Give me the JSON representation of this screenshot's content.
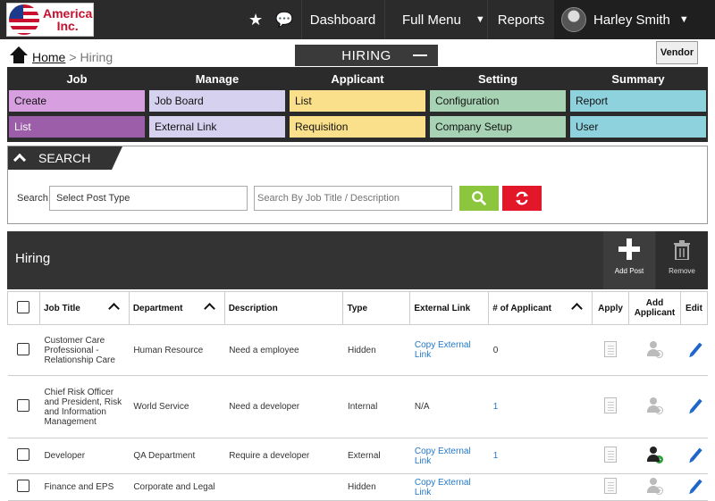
{
  "brand": {
    "line1": "America",
    "line2": "Inc."
  },
  "topnav": {
    "dashboard": "Dashboard",
    "full_menu": "Full Menu",
    "reports": "Reports",
    "user_name": "Harley Smith"
  },
  "breadcrumb": {
    "home": "Home",
    "separator": ">",
    "current": "Hiring"
  },
  "panel_tab": {
    "label": "HIRING"
  },
  "vendor": {
    "label": "Vendor"
  },
  "menu": {
    "headers": [
      "Job",
      "Manage",
      "Applicant",
      "Setting",
      "Summary"
    ],
    "row1": [
      "Create",
      "Job Board",
      "List",
      "Configuration",
      "Report"
    ],
    "row2": [
      "List",
      "External Link",
      "Requisition",
      "Company Setup",
      "User"
    ],
    "colors": {
      "job": "#d79fe0",
      "job_active": "#9c5ea8",
      "manage": "#d5d1ee",
      "applicant": "#fbe08b",
      "setting": "#a7d3b4",
      "summary": "#8ed2dd"
    }
  },
  "search": {
    "title": "SEARCH",
    "label": "Search:",
    "post_type": "Select Post Type",
    "keyword_placeholder": "Search By Job Title / Description"
  },
  "grid": {
    "title": "Hiring",
    "add_label": "Add Post",
    "remove_label": "Remove",
    "columns": [
      "Job Title",
      "Department",
      "Description",
      "Type",
      "External Link",
      "# of Applicant",
      "Apply",
      "Add Applicant",
      "Edit"
    ],
    "rows": [
      {
        "title": "Customer Care Professional - Relationship Care",
        "department": "Human Resource",
        "description": "Need a employee",
        "type": "Hidden",
        "external": "Copy External Link",
        "applicants": "0"
      },
      {
        "title": "Chief Risk Officer and President, Risk and Information Management",
        "department": "World Service",
        "description": "Need a developer",
        "type": "Internal",
        "external": "N/A",
        "applicants": "1"
      },
      {
        "title": "Developer",
        "department": "QA Department",
        "description": "Require a developer",
        "type": "External",
        "external": "Copy External Link",
        "applicants": "1"
      },
      {
        "title": "Finance and EPS",
        "department": "Corporate and Legal",
        "description": "",
        "type": "Hidden",
        "external": "Copy External Link",
        "applicants": ""
      }
    ]
  }
}
